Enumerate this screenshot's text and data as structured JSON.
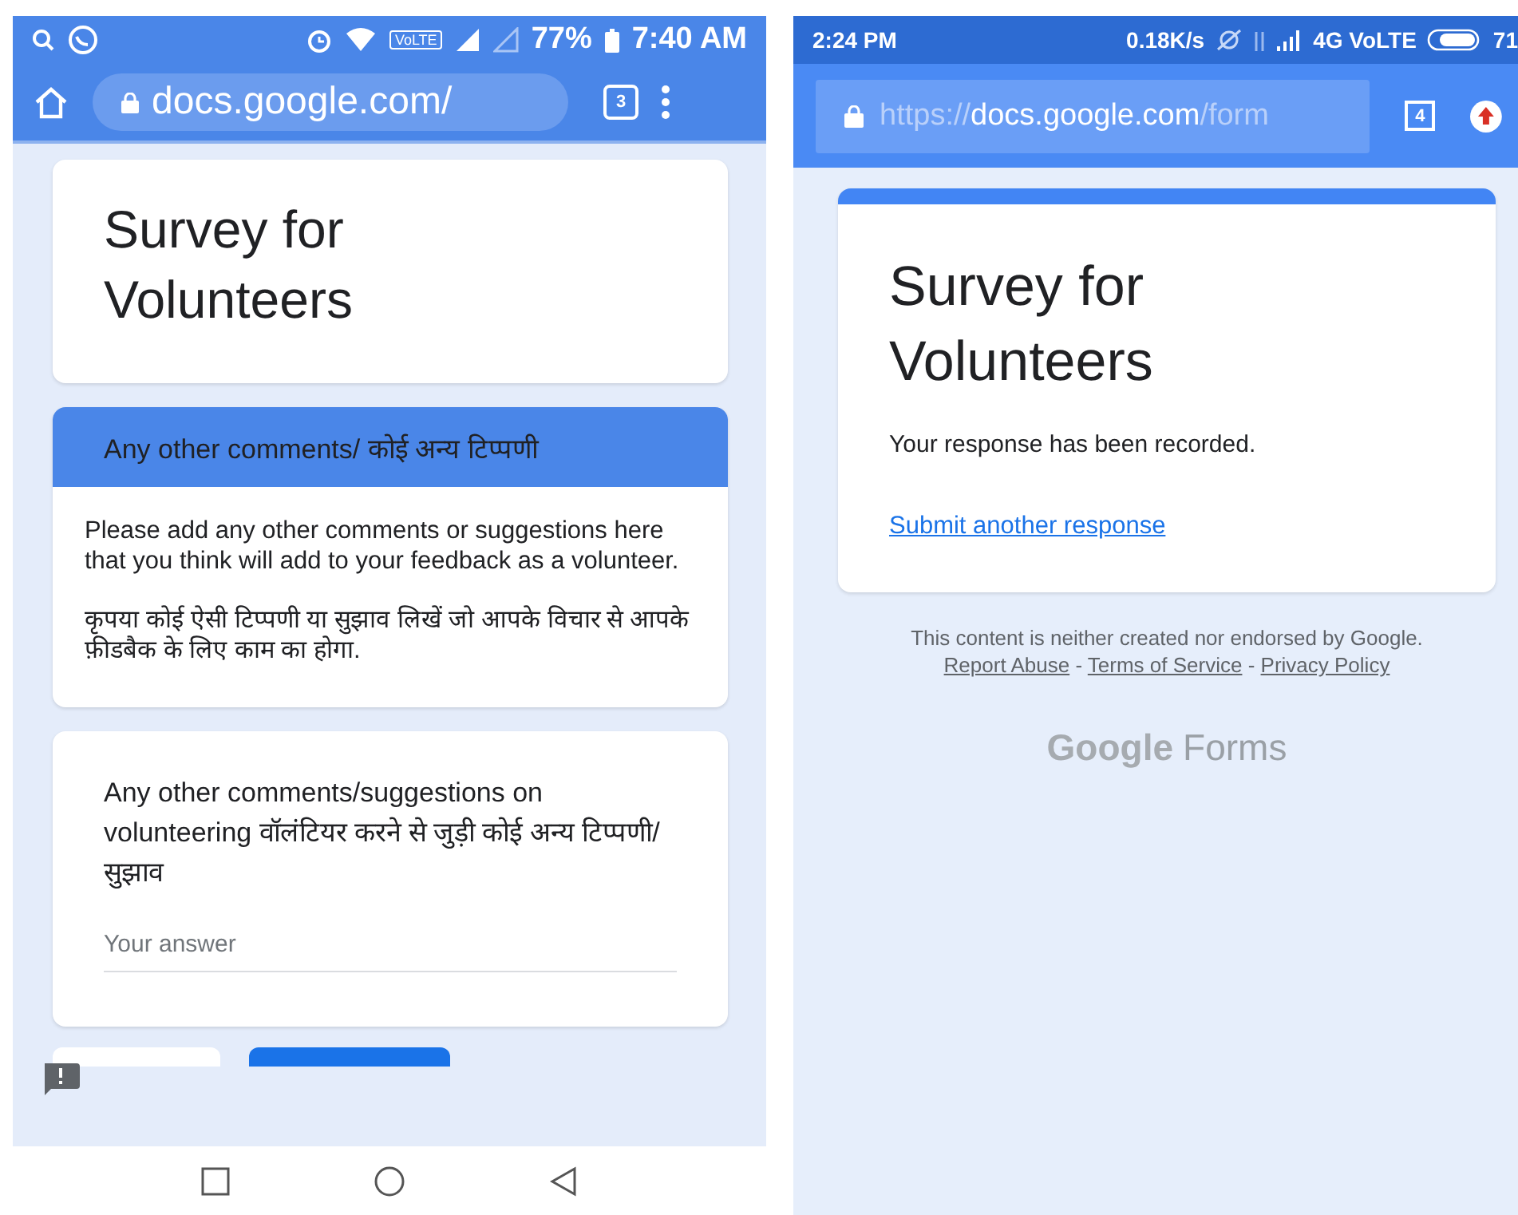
{
  "left_screen": {
    "status_bar": {
      "battery": "77%",
      "time": "7:40 AM",
      "network_badge": "VoLTE"
    },
    "toolbar": {
      "url": "docs.google.com/",
      "tab_count": "3"
    },
    "form": {
      "title": "Survey for Volunteers",
      "section": {
        "title": "Any other comments/ कोई अन्य टिप्पणी",
        "description_en": "Please add any other comments or suggestions here that you think will add to your feedback as a volunteer.",
        "description_hi": "कृपया कोई ऐसी टिप्पणी या सुझाव लिखें जो आपके विचार से आपके फ़ीडबैक के लिए काम का होगा."
      },
      "question": {
        "label": "Any other comments/suggestions on volunteering वॉलंटियर करने से जुड़ी कोई अन्य टिप्पणी/सुझाव",
        "placeholder": "Your answer"
      }
    }
  },
  "right_screen": {
    "status_bar": {
      "time": "2:24 PM",
      "speed": "0.18K/s",
      "network": "4G VoLTE",
      "battery": "71"
    },
    "toolbar": {
      "url_scheme": "https://",
      "url_host": "docs.google.com",
      "url_path": "/form",
      "tab_count": "4"
    },
    "confirmation": {
      "title": "Survey for Volunteers",
      "message": "Your response has been recorded.",
      "link": "Submit another response"
    },
    "footer": {
      "text": "This content is neither created nor endorsed by Google.",
      "separator": "-",
      "links": [
        "Report Abuse",
        "Terms of Service",
        "Privacy Policy"
      ]
    },
    "brand": {
      "google": "Google",
      "product": "Forms"
    }
  }
}
